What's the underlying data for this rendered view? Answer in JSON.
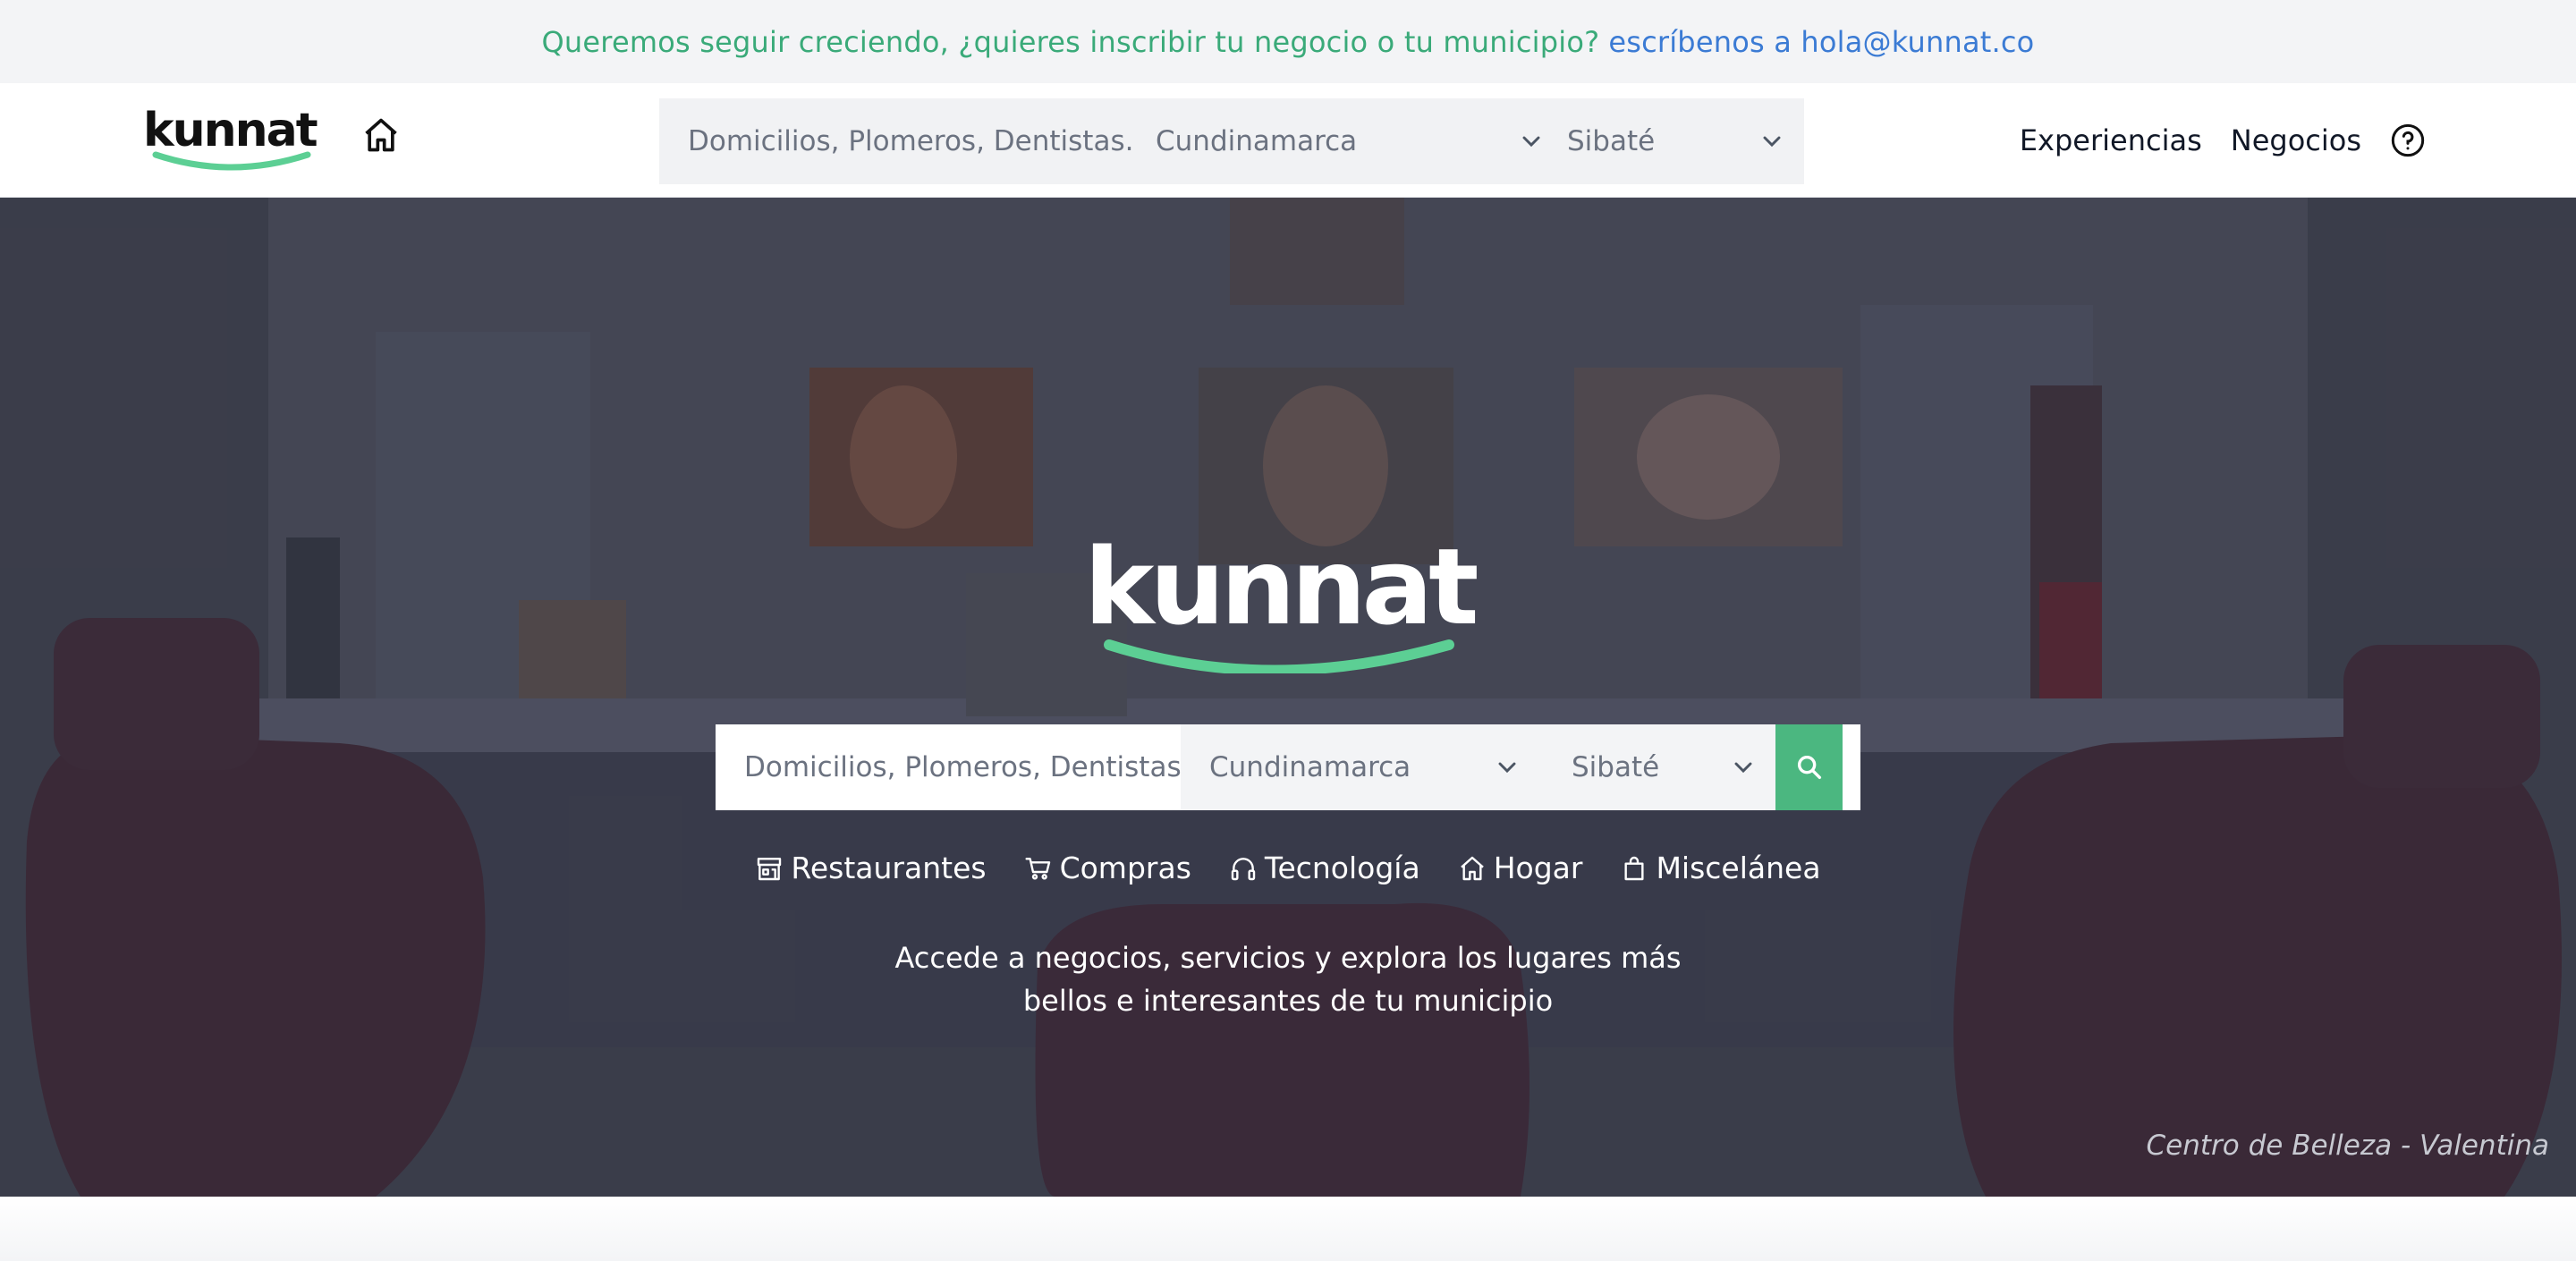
{
  "banner": {
    "lead": "Queremos seguir creciendo, ¿quieres inscribir tu negocio o tu municipio?",
    "contact": "escríbenos a hola@kunnat.co"
  },
  "header": {
    "logo_text": "kunnat",
    "search_placeholder": "Domicilios, Plomeros, Dentistas.",
    "department": "Cundinamarca",
    "municipality": "Sibaté",
    "nav": {
      "experiences": "Experiencias",
      "businesses": "Negocios"
    }
  },
  "hero": {
    "logo_text": "kunnat",
    "search_placeholder": "Domicilios, Plomeros, Dentistas.",
    "department": "Cundinamarca",
    "municipality": "Sibaté",
    "categories": [
      {
        "label": "Restaurantes",
        "icon": "store-icon"
      },
      {
        "label": "Compras",
        "icon": "cart-icon"
      },
      {
        "label": "Tecnología",
        "icon": "headphones-icon"
      },
      {
        "label": "Hogar",
        "icon": "home-icon"
      },
      {
        "label": "Miscelánea",
        "icon": "bag-icon"
      }
    ],
    "tagline_line1": "Accede a negocios, servicios y explora los lugares más",
    "tagline_line2": "bellos e interesantes de tu municipio",
    "caption": "Centro de Belleza - Valentina"
  },
  "colors": {
    "brand_green": "#4bb780",
    "banner_green": "#3aaa79",
    "banner_blue": "#3b7bd4"
  }
}
